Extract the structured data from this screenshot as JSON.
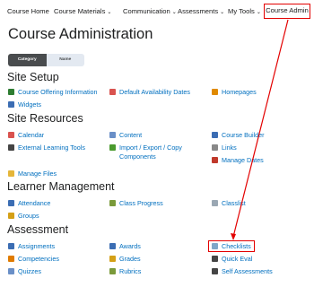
{
  "nav": {
    "items": [
      {
        "label": "Course Home",
        "chevron": false
      },
      {
        "label": "Course Materials",
        "chevron": true
      },
      {
        "label": "Communication",
        "chevron": true
      },
      {
        "label": "Assessments",
        "chevron": true
      },
      {
        "label": "My Tools",
        "chevron": true
      }
    ],
    "active": "Course Admin"
  },
  "page_title": "Course Administration",
  "toggle": {
    "category": "Category",
    "name": "Name"
  },
  "sections": [
    {
      "title": "Site Setup",
      "tools": [
        {
          "label": "Course Offering Information",
          "icon": "info-book-icon",
          "color": "#2e7d32"
        },
        {
          "label": "Default Availability Dates",
          "icon": "calendar-icon",
          "color": "#d9534f"
        },
        {
          "label": "Homepages",
          "icon": "home-icon",
          "color": "#e08a00"
        },
        {
          "label": "Widgets",
          "icon": "widgets-icon",
          "color": "#3b6db3"
        }
      ]
    },
    {
      "title": "Site Resources",
      "tools": [
        {
          "label": "Calendar",
          "icon": "calendar-icon",
          "color": "#d9534f"
        },
        {
          "label": "Content",
          "icon": "content-icon",
          "color": "#6a8fc7"
        },
        {
          "label": "Course Builder",
          "icon": "course-builder-icon",
          "color": "#3b6db3"
        },
        {
          "label": "External Learning Tools",
          "icon": "external-tools-icon",
          "color": "#444444"
        },
        {
          "label": "Import / Export / Copy Components",
          "icon": "import-export-icon",
          "color": "#4a9a2e"
        },
        {
          "label": "Links",
          "icon": "links-icon",
          "color": "#888888"
        },
        {
          "label": "Manage Dates",
          "icon": "manage-dates-icon",
          "color": "#c0392b"
        },
        {
          "label": "Manage Files",
          "icon": "folder-icon",
          "color": "#e5b63a"
        }
      ]
    },
    {
      "title": "Learner Management",
      "tools": [
        {
          "label": "Attendance",
          "icon": "attendance-icon",
          "color": "#3b6db3"
        },
        {
          "label": "Class Progress",
          "icon": "class-progress-icon",
          "color": "#7a9a3a"
        },
        {
          "label": "Classlist",
          "icon": "classlist-icon",
          "color": "#9aa7b3"
        },
        {
          "label": "Groups",
          "icon": "groups-icon",
          "color": "#d4a017"
        }
      ]
    },
    {
      "title": "Assessment",
      "tools": [
        {
          "label": "Assignments",
          "icon": "assignments-icon",
          "color": "#3b6db3"
        },
        {
          "label": "Awards",
          "icon": "awards-icon",
          "color": "#3b6db3"
        },
        {
          "label": "Checklists",
          "icon": "checklist-icon",
          "color": "#7fa7c9"
        },
        {
          "label": "Competencies",
          "icon": "competencies-icon",
          "color": "#e07b00"
        },
        {
          "label": "Grades",
          "icon": "grades-icon",
          "color": "#d4a017"
        },
        {
          "label": "Quick Eval",
          "icon": "quick-eval-icon",
          "color": "#444444"
        },
        {
          "label": "Quizzes",
          "icon": "quizzes-icon",
          "color": "#6a8fc7"
        },
        {
          "label": "Rubrics",
          "icon": "rubrics-icon",
          "color": "#7a9a3a"
        },
        {
          "label": "Self Assessments",
          "icon": "self-assessments-icon",
          "color": "#444444"
        }
      ]
    }
  ],
  "colors": {
    "link": "#006fbf",
    "highlight": "#e30000",
    "toggle_on": "#494c4e",
    "toggle_off": "#e3e9f1"
  }
}
